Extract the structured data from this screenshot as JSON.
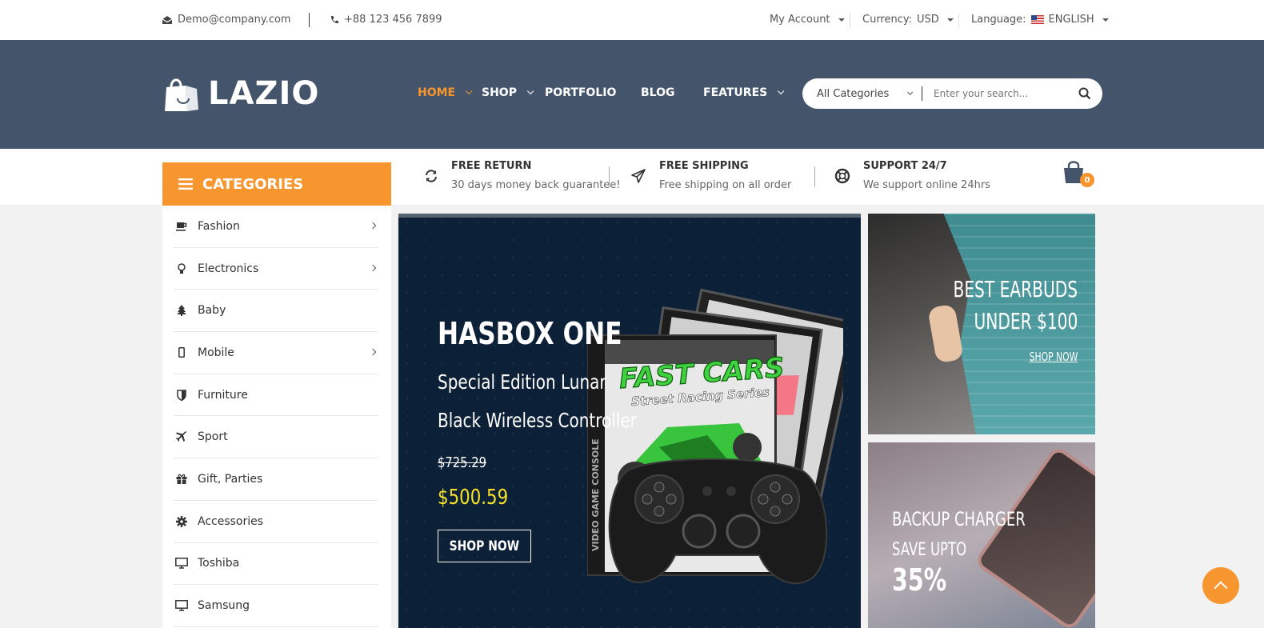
{
  "topbar": {
    "email": "Demo@company.com",
    "phone": "+88 123 456 7899",
    "account": "My Account",
    "currency_label": "Currency:",
    "currency_value": "USD",
    "language_label": "Language:",
    "language_value": "ENGLISH"
  },
  "brand": {
    "logo_text": "LAZIO"
  },
  "nav": {
    "items": [
      {
        "label": "HOME"
      },
      {
        "label": "SHOP"
      },
      {
        "label": "PORTFOLIO"
      },
      {
        "label": "BLOG"
      },
      {
        "label": "FEATURES"
      }
    ]
  },
  "search": {
    "category": "All Categories",
    "placeholder": "Enter your search..."
  },
  "features": [
    {
      "title": "FREE RETURN",
      "subtitle": "30 days money back guarantee!"
    },
    {
      "title": "FREE SHIPPING",
      "subtitle": "Free shipping on all order"
    },
    {
      "title": "SUPPORT 24/7",
      "subtitle": "We support online 24hrs"
    }
  ],
  "cart": {
    "count": "0"
  },
  "categories": {
    "title": "CATEGORIES",
    "items": [
      {
        "label": "Fashion"
      },
      {
        "label": "Electronics"
      },
      {
        "label": "Baby"
      },
      {
        "label": "Mobile"
      },
      {
        "label": "Furniture"
      },
      {
        "label": "Sport"
      },
      {
        "label": "Gift, Parties"
      },
      {
        "label": "Accessories"
      },
      {
        "label": "Toshiba"
      },
      {
        "label": "Samsung"
      }
    ]
  },
  "hero": {
    "title": "HASBOX ONE",
    "line1": "Special Edition Lunar",
    "line2": "Black Wireless Controller",
    "old_price": "$725.29",
    "price": "$500.59",
    "button": "SHOP NOW",
    "game_title": "FAST CARS",
    "game_subtitle": "Street Racing Series",
    "game_spine": "VIDEO GAME CONSOLE"
  },
  "banner1": {
    "line1": "BEST EARBUDS",
    "line2": "UNDER $100",
    "cta": "SHOP NOW"
  },
  "banner2": {
    "line1": "BACKUP CHARGER",
    "line2": "SAVE UPTO",
    "line3": "35%"
  },
  "colors": {
    "accent": "#f7962f",
    "header": "#44546b",
    "hero_bg": "#0c2137",
    "price": "#f5e02a"
  }
}
